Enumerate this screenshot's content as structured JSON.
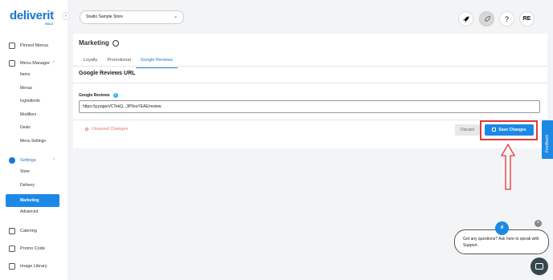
{
  "brand": {
    "name": "deliverit",
    "sub": "GOLO"
  },
  "sidebar": {
    "collapse_glyph": "‹",
    "pinned": "Pinned Menus",
    "menu_manager": {
      "label": "Menu Manager",
      "items": [
        "Items",
        "Menus",
        "Ingredients",
        "Modifiers",
        "Deals",
        "Menu Settings"
      ]
    },
    "settings": {
      "label": "Settings",
      "items": [
        "Store",
        "Delivery",
        "Marketing",
        "Advanced"
      ]
    },
    "catering": "Catering",
    "promo": "Promo Code",
    "library": "Image Library"
  },
  "topbar": {
    "store_selected": "Studio Sample Store",
    "chevron": "⌄",
    "help_glyph": "?",
    "user_initials": "RE"
  },
  "page": {
    "title": "Marketing",
    "tabs": [
      "Loyalty",
      "Promotional",
      "Google Reviews"
    ],
    "active_tab": "Google Reviews",
    "section_title": "Google Reviews URL",
    "field_label": "Google Reviews",
    "field_info_glyph": "?",
    "field_value": "https://g.page/r/CTekQ...3P9suYEAE/review",
    "unsaved_text": "Unsaved Changes",
    "discard_label": "Discard",
    "save_label": "Save Changes"
  },
  "feedback_label": "Feedback",
  "chat": {
    "avatar_letter": "d",
    "message": "Got any questions? Ask here to speak with Support.",
    "close_glyph": "×"
  },
  "colors": {
    "accent": "#1e88e5",
    "highlight": "#e53935",
    "unsaved": "#e57373"
  }
}
